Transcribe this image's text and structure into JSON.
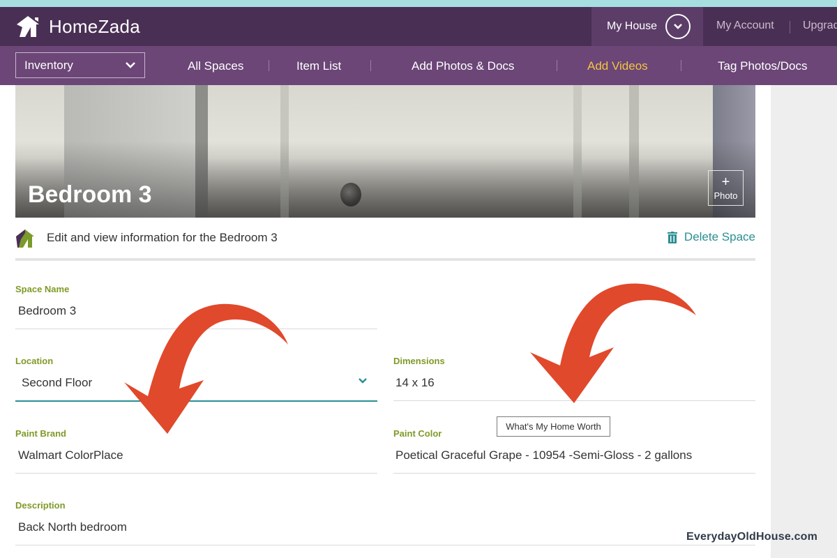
{
  "header": {
    "app_name": "HomeZada",
    "my_house_label": "My House",
    "my_account_label": "My Account",
    "upgrade_label": "Upgrade"
  },
  "subnav": {
    "section_select_value": "Inventory",
    "items": [
      {
        "label": "All Spaces"
      },
      {
        "label": "Item List"
      },
      {
        "label": "Add Photos & Docs"
      },
      {
        "label": "Add Videos",
        "active": true
      },
      {
        "label": "Tag Photos/Docs"
      }
    ]
  },
  "banner": {
    "title": "Bedroom 3",
    "photo_button_label": "Photo"
  },
  "info": {
    "text": "Edit and view information for the Bedroom 3",
    "delete_label": "Delete Space"
  },
  "form": {
    "space_name": {
      "label": "Space Name",
      "value": "Bedroom 3"
    },
    "location": {
      "label": "Location",
      "value": "Second Floor"
    },
    "dimensions": {
      "label": "Dimensions",
      "value": "14 x 16"
    },
    "paint_brand": {
      "label": "Paint Brand",
      "value": "Walmart ColorPlace"
    },
    "paint_color": {
      "label": "Paint Color",
      "value": "Poetical Graceful Grape - 10954 -Semi-Gloss - 2 gallons"
    },
    "description": {
      "label": "Description",
      "value": "Back North bedroom"
    }
  },
  "tooltip": "What's My Home Worth",
  "watermark": "EverydayOldHouse.com",
  "colors": {
    "header_bg": "#4a2f55",
    "subnav_bg": "#6b4677",
    "active_nav": "#f4c542",
    "field_label": "#7f9a28",
    "accent_teal": "#2a8e93",
    "annotation_arrow": "#e0492b"
  },
  "icons": {
    "logo": "house-logo-icon",
    "dropdown": "chevron-down-icon",
    "delete": "trash-icon",
    "add_photo": "plus-icon"
  }
}
